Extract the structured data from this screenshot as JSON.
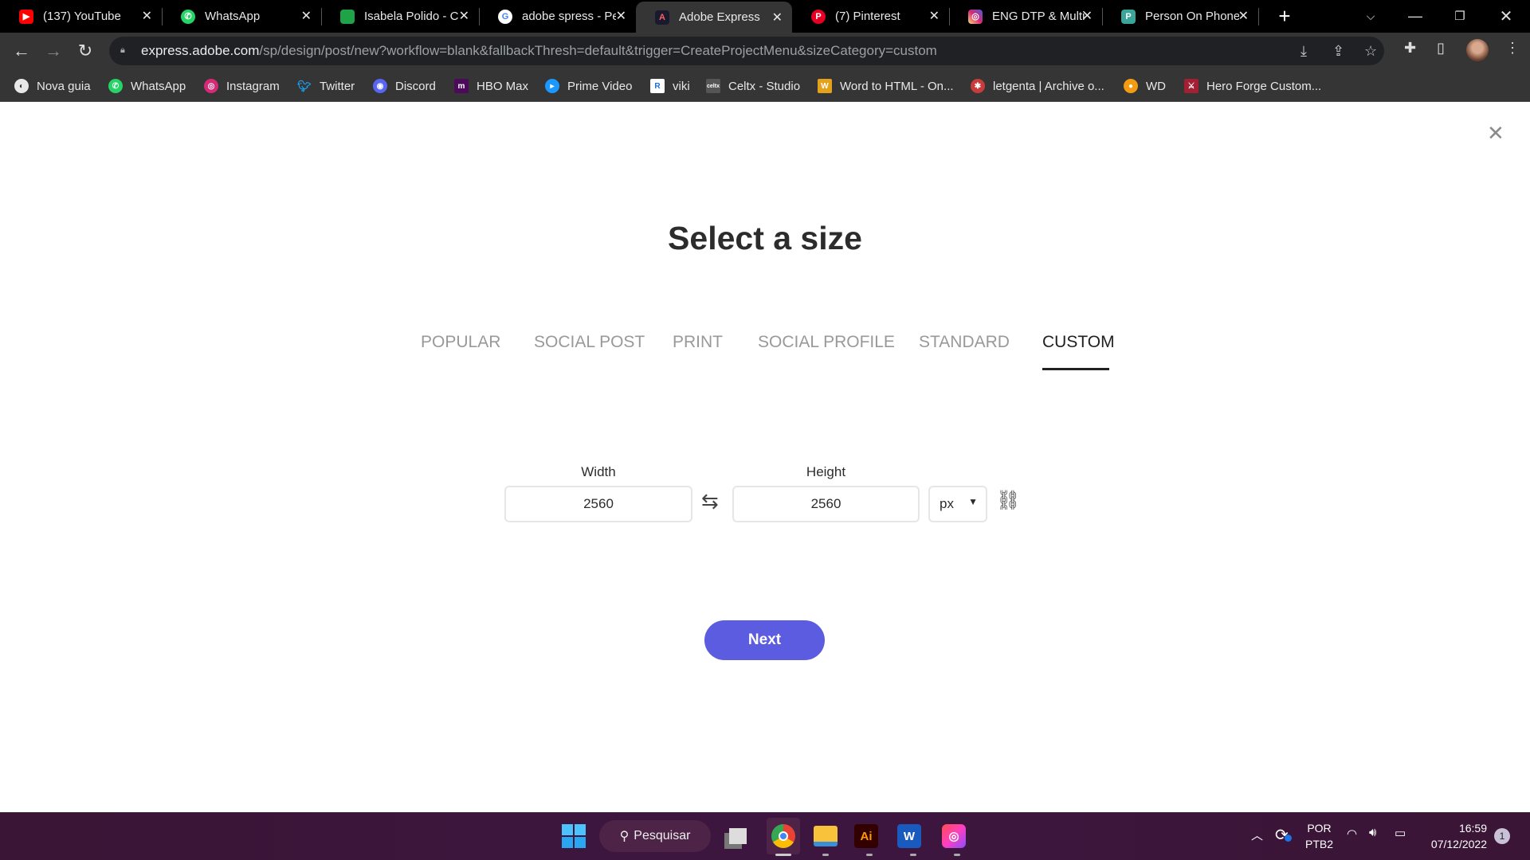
{
  "browser": {
    "tabs": [
      {
        "title": "(137) YouTube",
        "icon": "youtube-icon",
        "color": "#ff0000"
      },
      {
        "title": "WhatsApp",
        "icon": "whatsapp-icon",
        "color": "#25d366"
      },
      {
        "title": "Isabela Polido - C",
        "icon": "google-chat-icon",
        "color": "#1ea446"
      },
      {
        "title": "adobe spress - Pe",
        "icon": "google-icon",
        "color": "#ffffff"
      },
      {
        "title": "Adobe Express",
        "icon": "adobe-express-icon",
        "color": "#1a1a2e",
        "active": true
      },
      {
        "title": "(7) Pinterest",
        "icon": "pinterest-icon",
        "color": "#e60023"
      },
      {
        "title": "ENG DTP & Multi",
        "icon": "instagram-icon",
        "color": "#d62976"
      },
      {
        "title": "Person On Phone",
        "icon": "freepik-icon",
        "color": "#3aa59a"
      }
    ],
    "url_host": "express.adobe.com",
    "url_path": "/sp/design/post/new?workflow=blank&fallbackThresh=default&trigger=CreateProjectMenu&sizeCategory=custom",
    "bookmarks": [
      {
        "label": "Nova guia",
        "color": "#e8e8e8"
      },
      {
        "label": "WhatsApp",
        "color": "#25d366"
      },
      {
        "label": "Instagram",
        "color": "#d62976"
      },
      {
        "label": "Twitter",
        "color": "#1da1f2"
      },
      {
        "label": "Discord",
        "color": "#5865f2"
      },
      {
        "label": "HBO Max",
        "color": "#4b0a5a"
      },
      {
        "label": "Prime Video",
        "color": "#1a98ff"
      },
      {
        "label": "viki",
        "color": "#1b6fd1"
      },
      {
        "label": "Celtx - Studio",
        "color": "#555555"
      },
      {
        "label": "Word to HTML - On...",
        "color": "#e3a21a"
      },
      {
        "label": "letgenta | Archive o...",
        "color": "#c83c3c"
      },
      {
        "label": "WD",
        "color": "#f39c12"
      },
      {
        "label": "Hero Forge Custom...",
        "color": "#a31f34"
      }
    ]
  },
  "dialog": {
    "title": "Select a size",
    "categories": [
      "POPULAR",
      "SOCIAL POST",
      "PRINT",
      "SOCIAL PROFILE",
      "STANDARD",
      "CUSTOM"
    ],
    "active_category": "CUSTOM",
    "width_label": "Width",
    "height_label": "Height",
    "width_value": "2560",
    "height_value": "2560",
    "unit": "px",
    "next_label": "Next",
    "accent": "#5c5ce0"
  },
  "taskbar": {
    "search_label": "Pesquisar",
    "lang_top": "POR",
    "lang_bottom": "PTB2",
    "time": "16:59",
    "date": "07/12/2022",
    "notifications": "1"
  }
}
